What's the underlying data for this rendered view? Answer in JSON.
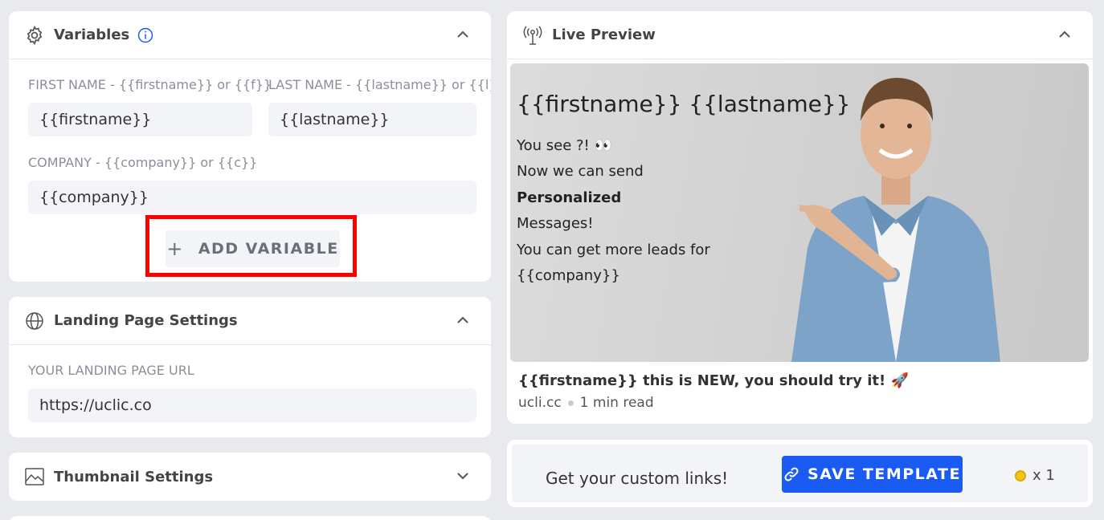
{
  "variables": {
    "title": "Variables",
    "fields": [
      {
        "label": "FIRST NAME - {{firstname}} or {{f}}",
        "value": "{{firstname}}"
      },
      {
        "label": "LAST NAME - {{lastname}} or {{l}}",
        "value": "{{lastname}}"
      },
      {
        "label": "COMPANY - {{company}} or {{c}}",
        "value": "{{company}}"
      }
    ],
    "add_button": "ADD VARIABLE"
  },
  "landing": {
    "title": "Landing Page Settings",
    "url_label": "YOUR LANDING PAGE URL",
    "url_value": "https://uclic.co"
  },
  "thumbnail": {
    "title": "Thumbnail Settings"
  },
  "preview": {
    "title": "Live Preview",
    "headline": "{{firstname}} {{lastname}}",
    "lines": [
      "You see ?! 👀",
      "Now we can send",
      "Personalized",
      "Messages!",
      "You can get more leads for",
      "{{company}}"
    ],
    "caption": "{{firstname}} this is NEW, you should try it! 🚀",
    "domain": "ucli.cc",
    "read_time": "1 min read"
  },
  "footer": {
    "text": "Get your custom links!",
    "save_button": "SAVE TEMPLATE",
    "credits": "x 1"
  },
  "colors": {
    "accent": "#1a5cf3",
    "highlight": "#ff0000",
    "input_bg": "#f2f4f8"
  }
}
